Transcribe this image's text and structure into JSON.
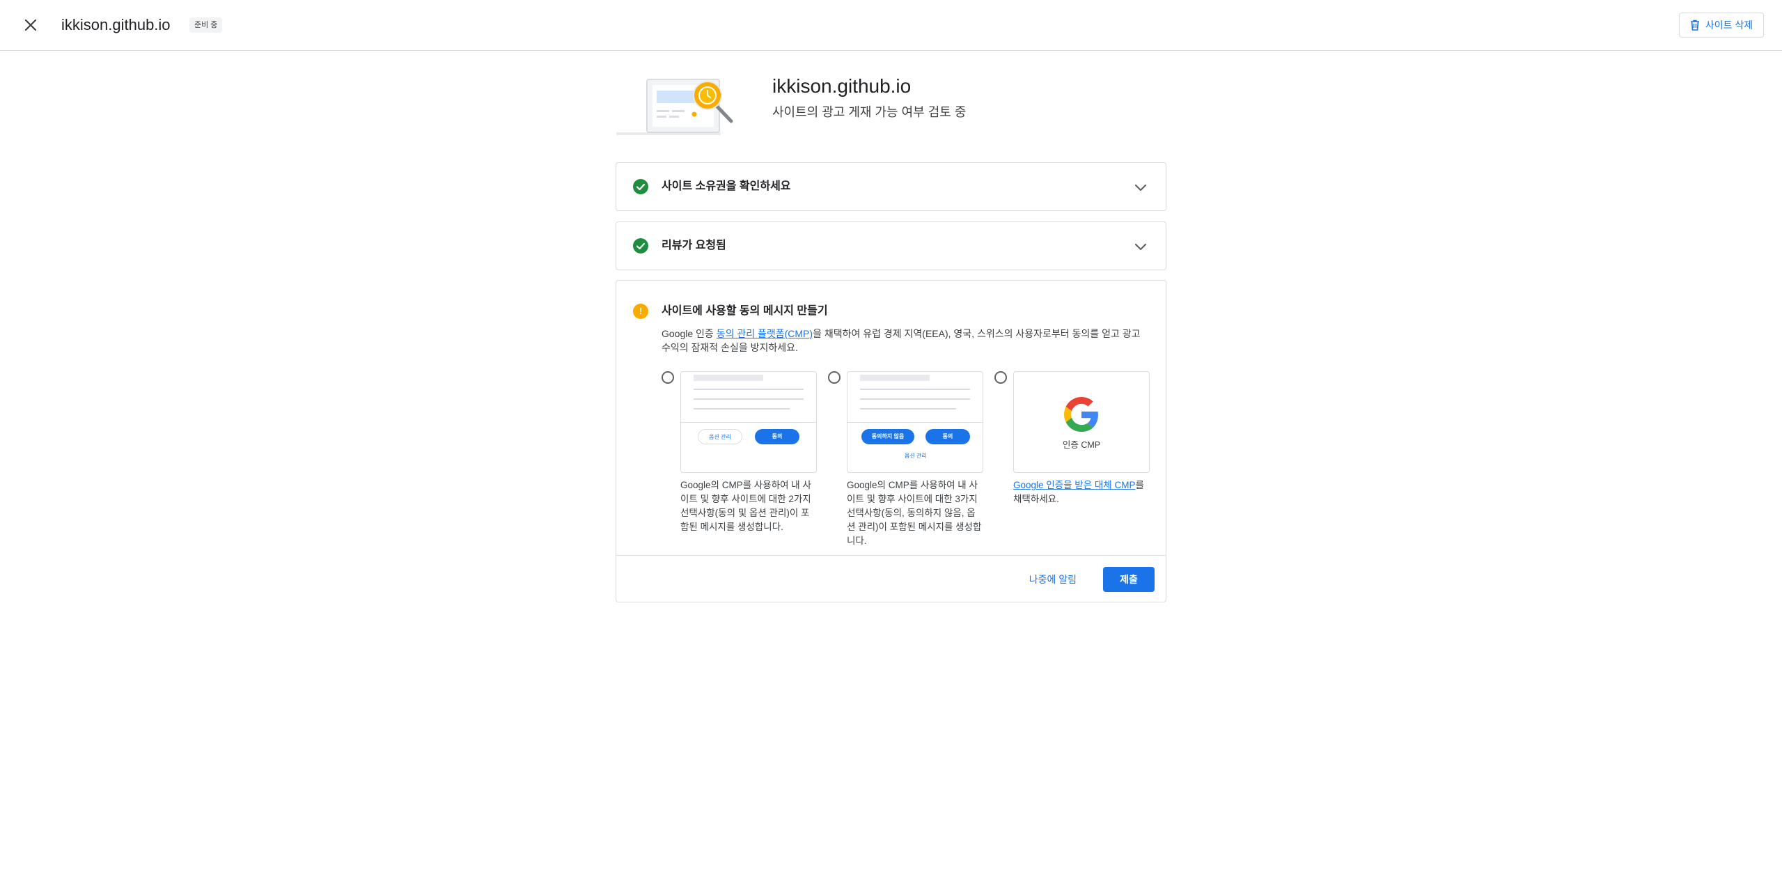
{
  "header": {
    "title": "ikkison.github.io",
    "status_chip": "준비 중",
    "delete_label": "사이트 삭제"
  },
  "hero": {
    "title": "ikkison.github.io",
    "subtitle": "사이트의 광고 게재 가능 여부 검토 중"
  },
  "steps": [
    {
      "title": "사이트 소유권을 확인하세요",
      "status": "complete"
    },
    {
      "title": "리뷰가 요청됨",
      "status": "complete"
    },
    {
      "title": "사이트에 사용할 동의 메시지 만들기",
      "status": "action-required"
    }
  ],
  "consent": {
    "desc_prefix": "Google 인증 ",
    "desc_link": "동의 관리 플랫폼(CMP)",
    "desc_suffix": "을 채택하여 유럽 경제 지역(EEA), 영국, 스위스의 사용자로부터 동의를 얻고 광고 수익의 잠재적 손실을 방지하세요.",
    "options": [
      {
        "preview_buttons": [
          "옵션 관리",
          "동의"
        ],
        "text": "Google의 CMP를 사용하여 내 사이트 및 향후 사이트에 대한 2가지 선택사항(동의 및 옵션 관리)이 포함된 메시지를 생성합니다."
      },
      {
        "preview_buttons": [
          "동의하지 않음",
          "동의"
        ],
        "preview_link": "옵션 관리",
        "text": "Google의 CMP를 사용하여 내 사이트 및 향후 사이트에 대한 3가지 선택사항(동의, 동의하지 않음, 옵션 관리)이 포함된 메시지를 생성합니다."
      },
      {
        "preview_label": "인증 CMP",
        "text_link": "Google 인증을 받은 대체 CMP",
        "text_suffix": "를 채택하세요."
      }
    ],
    "later_label": "나중에 알림",
    "submit_label": "제출"
  },
  "colors": {
    "accent": "#1a73e8",
    "success": "#1e8e3e",
    "warning": "#f9ab00"
  }
}
